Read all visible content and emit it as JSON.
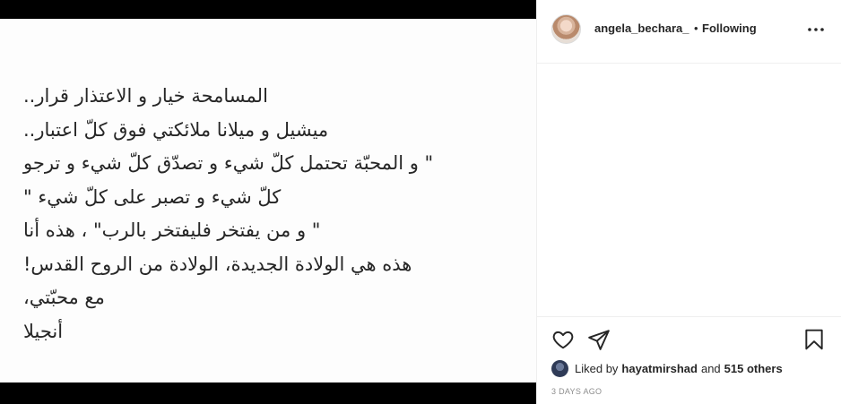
{
  "post": {
    "lines": [
      "المسامحة خيار و الاعتذار قرار..",
      "ميشيل و ميلانا ملائكتي فوق كلّ اعتبار..",
      "\" و المحبّة تحتمل كلّ شيء و تصدّق كلّ شيء و ترجو",
      "كلّ شيء و تصبر على كلّ شيء \"",
      "\" و من يفتخر فليفتخر بالرب\" ، هذه أنا",
      "هذه هي الولادة الجديدة، الولادة من الروح القدس!",
      "مع محبّتي،",
      "أنجيلا"
    ]
  },
  "header": {
    "username": "angela_bechara_",
    "separator": "•",
    "follow_status": "Following",
    "more_icon": "more-horizontal-icon"
  },
  "actions": {
    "icons": [
      "heart-icon",
      "share-icon",
      "bookmark-icon"
    ]
  },
  "likes": {
    "prefix": "Liked by",
    "user": "hayatmirshad",
    "connector": "and",
    "others": "515 others"
  },
  "timestamp": "3 DAYS AGO",
  "colors": {
    "text": "#262626",
    "muted": "#8e8e8e",
    "border": "#efefef",
    "media_bg": "#000000"
  }
}
